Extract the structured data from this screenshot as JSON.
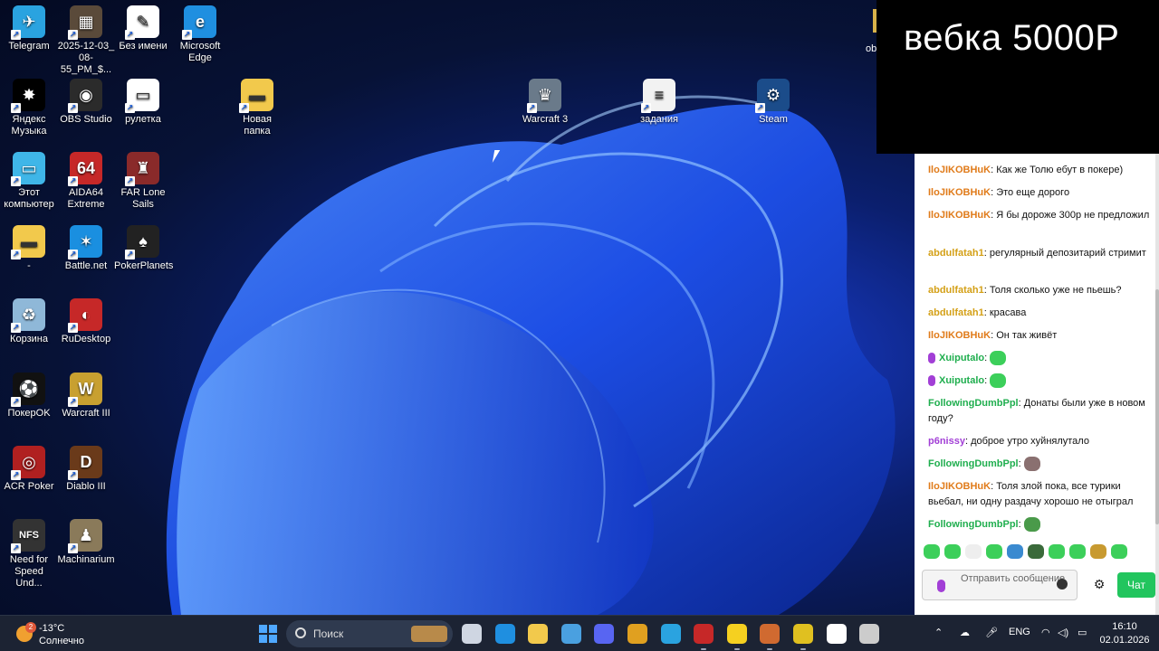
{
  "webcam": {
    "text": "вебка 5000Р",
    "partial_label": "ob"
  },
  "desktop": {
    "icons": [
      {
        "label": "Telegram",
        "icon": "telegram-icon",
        "color": "#2aa3e0",
        "glyph": "✈"
      },
      {
        "label": "2025-12-03_\n08-55_PM_$...",
        "icon": "image-file-icon",
        "color": "#5a4a3a",
        "glyph": "▦"
      },
      {
        "label": "Без имени",
        "icon": "paint-file-icon",
        "color": "#ffffff",
        "glyph": "✎"
      },
      {
        "label": "Microsoft\nEdge",
        "icon": "edge-icon",
        "color": "#1f8fe0",
        "glyph": "e"
      },
      {
        "label": "Яндекс\nМузыка",
        "icon": "yandex-music-icon",
        "color": "#000000",
        "glyph": "✸"
      },
      {
        "label": "OBS Studio",
        "icon": "obs-icon",
        "color": "#2b2b2b",
        "glyph": "◉"
      },
      {
        "label": "рулетка",
        "icon": "roulette-file-icon",
        "color": "#ffffff",
        "glyph": "▭"
      },
      {
        "label": "Новая папка",
        "icon": "folder-icon",
        "color": "#f2c94c",
        "glyph": "▬"
      },
      {
        "label": "Warcraft 3",
        "icon": "warcraft3-icon",
        "color": "#6a7a8a",
        "glyph": "♛"
      },
      {
        "label": "задания",
        "icon": "text-file-icon",
        "color": "#f2f2f2",
        "glyph": "≡"
      },
      {
        "label": "Steam",
        "icon": "steam-icon",
        "color": "#1b4c8a",
        "glyph": "⚙"
      },
      {
        "label": "Этот\nкомпьютер",
        "icon": "this-pc-icon",
        "color": "#3fb6e8",
        "glyph": "▭"
      },
      {
        "label": "AIDA64\nExtreme",
        "icon": "aida64-icon",
        "color": "#c62828",
        "glyph": "64"
      },
      {
        "label": "FAR Lone\nSails",
        "icon": "far-lone-sails-icon",
        "color": "#8a2a2a",
        "glyph": "♜"
      },
      {
        "label": "-",
        "icon": "folder-icon",
        "color": "#f2c94c",
        "glyph": "▬"
      },
      {
        "label": "Battle.net",
        "icon": "battlenet-icon",
        "color": "#1a8fe0",
        "glyph": "✶"
      },
      {
        "label": "PokerPlanets",
        "icon": "pokerplanets-icon",
        "color": "#222222",
        "glyph": "♠"
      },
      {
        "label": "Корзина",
        "icon": "recycle-bin-icon",
        "color": "#8fb8d8",
        "glyph": "♻"
      },
      {
        "label": "RuDesktop",
        "icon": "rudesktop-icon",
        "color": "#c62828",
        "glyph": "◐"
      },
      {
        "label": "ПокерOK",
        "icon": "pokerok-icon",
        "color": "#111111",
        "glyph": "⚽"
      },
      {
        "label": "Warcraft III",
        "icon": "warcraft-iii-icon",
        "color": "#c8a030",
        "glyph": "W"
      },
      {
        "label": "ACR Poker",
        "icon": "acr-poker-icon",
        "color": "#b02020",
        "glyph": "◎"
      },
      {
        "label": "Diablo III",
        "icon": "diablo-iii-icon",
        "color": "#6a3a1a",
        "glyph": "D"
      },
      {
        "label": "Need for\nSpeed Und...",
        "icon": "nfs-icon",
        "color": "#333333",
        "glyph": "NFS"
      },
      {
        "label": "Machinarium",
        "icon": "machinarium-icon",
        "color": "#8a7a5a",
        "glyph": "♟"
      }
    ]
  },
  "chat": {
    "messages": [
      {
        "nick": "IloJIKOBHuK",
        "nick_class": "n-orange",
        "text": "Как же Толю ебут в покере)",
        "emotes": []
      },
      {
        "nick": "IloJIKOBHuK",
        "nick_class": "n-orange",
        "text": "Это еще дорого",
        "emotes": []
      },
      {
        "nick": "IloJIKOBHuK",
        "nick_class": "n-orange",
        "text": "Я бы дороже 300р не предложил",
        "emotes": []
      },
      {
        "nick": "abdulfatah1",
        "nick_class": "n-yellow",
        "text": "регулярный депозитарий стримит",
        "emotes": []
      },
      {
        "nick": "abdulfatah1",
        "nick_class": "n-yellow",
        "text": "Толя сколько уже не пьешь?",
        "emotes": []
      },
      {
        "nick": "abdulfatah1",
        "nick_class": "n-yellow",
        "text": "красава",
        "emotes": []
      },
      {
        "nick": "IloJIKOBHuK",
        "nick_class": "n-orange",
        "text": "Он так живёт",
        "emotes": []
      },
      {
        "nick": "Xuiputalo",
        "nick_class": "n-green",
        "text": "",
        "emotes": [
          "#3ccf5a"
        ]
      },
      {
        "nick": "Xuiputalo",
        "nick_class": "n-green",
        "text": "",
        "emotes": [
          "#3ccf5a"
        ]
      },
      {
        "nick": "FollowingDumbPpl",
        "nick_class": "n-green",
        "text": "Донаты были уже в новом году?",
        "emotes": []
      },
      {
        "nick": "p6nissy",
        "nick_class": "n-purple",
        "text": "доброе утро хуйнялутало",
        "emotes": []
      },
      {
        "nick": "FollowingDumbPpl",
        "nick_class": "n-green",
        "text": "",
        "emotes": [
          "#8a7070"
        ]
      },
      {
        "nick": "IloJIKOBHuK",
        "nick_class": "n-orange",
        "text": "Толя злой пока, все турики вьебал, ни одну раздачу хорошо не отыграл",
        "emotes": []
      },
      {
        "nick": "FollowingDumbPpl",
        "nick_class": "n-green",
        "text": "",
        "emotes": [
          "#4a9a4a"
        ]
      }
    ],
    "emote_row": [
      "#3ccf5a",
      "#3ccf5a",
      "#eeeeee",
      "#3ccf5a",
      "#3a8ad0",
      "#3a6a3a",
      "#3ccf5a",
      "#3ccf5a",
      "#c89a30",
      "#3ccf5a"
    ],
    "input_placeholder": "Отправить сообщение",
    "send_label": "Чат"
  },
  "taskbar": {
    "weather_badge": "2",
    "temperature": "-13°C",
    "condition": "Солнечно",
    "search_placeholder": "Поиск",
    "apps": [
      {
        "icon": "task-view-icon",
        "color": "#cfd6e2"
      },
      {
        "icon": "edge-icon",
        "color": "#1f8fe0"
      },
      {
        "icon": "file-explorer-icon",
        "color": "#f2c94c"
      },
      {
        "icon": "cortana-icon",
        "color": "#4aa0e0"
      },
      {
        "icon": "discord-icon",
        "color": "#5865f2"
      },
      {
        "icon": "chrome-icon",
        "color": "#e0a020"
      },
      {
        "icon": "telegram-icon",
        "color": "#2aa3e0"
      },
      {
        "icon": "rudesktop-icon",
        "color": "#c62828"
      },
      {
        "icon": "yandex-music-icon",
        "color": "#f5d020"
      },
      {
        "icon": "poker-app-icon",
        "color": "#d06a30"
      },
      {
        "icon": "aida-tray-icon",
        "color": "#e0c020"
      },
      {
        "icon": "pokerok-icon",
        "color": "#ffffff"
      },
      {
        "icon": "obs-icon",
        "color": "#cccccc"
      }
    ],
    "tray_language": "ENG",
    "time": "16:10",
    "date": "02.01.2026"
  }
}
